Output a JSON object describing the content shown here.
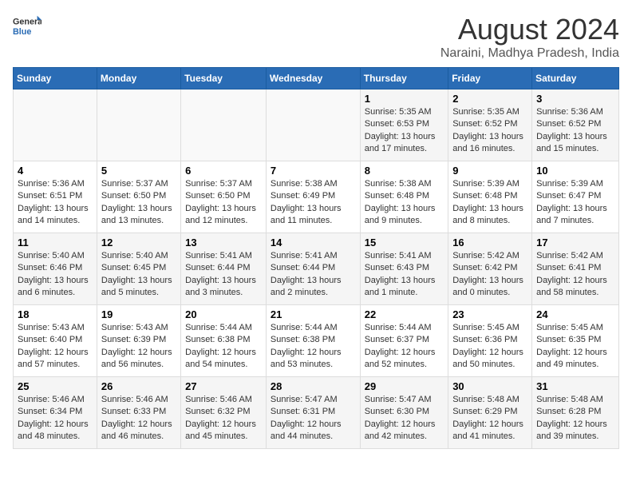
{
  "logo": {
    "line1": "General",
    "line2": "Blue"
  },
  "title": "August 2024",
  "subtitle": "Naraini, Madhya Pradesh, India",
  "days_of_week": [
    "Sunday",
    "Monday",
    "Tuesday",
    "Wednesday",
    "Thursday",
    "Friday",
    "Saturday"
  ],
  "weeks": [
    [
      {
        "day": "",
        "info": ""
      },
      {
        "day": "",
        "info": ""
      },
      {
        "day": "",
        "info": ""
      },
      {
        "day": "",
        "info": ""
      },
      {
        "day": "1",
        "info": "Sunrise: 5:35 AM\nSunset: 6:53 PM\nDaylight: 13 hours and 17 minutes."
      },
      {
        "day": "2",
        "info": "Sunrise: 5:35 AM\nSunset: 6:52 PM\nDaylight: 13 hours and 16 minutes."
      },
      {
        "day": "3",
        "info": "Sunrise: 5:36 AM\nSunset: 6:52 PM\nDaylight: 13 hours and 15 minutes."
      }
    ],
    [
      {
        "day": "4",
        "info": "Sunrise: 5:36 AM\nSunset: 6:51 PM\nDaylight: 13 hours and 14 minutes."
      },
      {
        "day": "5",
        "info": "Sunrise: 5:37 AM\nSunset: 6:50 PM\nDaylight: 13 hours and 13 minutes."
      },
      {
        "day": "6",
        "info": "Sunrise: 5:37 AM\nSunset: 6:50 PM\nDaylight: 13 hours and 12 minutes."
      },
      {
        "day": "7",
        "info": "Sunrise: 5:38 AM\nSunset: 6:49 PM\nDaylight: 13 hours and 11 minutes."
      },
      {
        "day": "8",
        "info": "Sunrise: 5:38 AM\nSunset: 6:48 PM\nDaylight: 13 hours and 9 minutes."
      },
      {
        "day": "9",
        "info": "Sunrise: 5:39 AM\nSunset: 6:48 PM\nDaylight: 13 hours and 8 minutes."
      },
      {
        "day": "10",
        "info": "Sunrise: 5:39 AM\nSunset: 6:47 PM\nDaylight: 13 hours and 7 minutes."
      }
    ],
    [
      {
        "day": "11",
        "info": "Sunrise: 5:40 AM\nSunset: 6:46 PM\nDaylight: 13 hours and 6 minutes."
      },
      {
        "day": "12",
        "info": "Sunrise: 5:40 AM\nSunset: 6:45 PM\nDaylight: 13 hours and 5 minutes."
      },
      {
        "day": "13",
        "info": "Sunrise: 5:41 AM\nSunset: 6:44 PM\nDaylight: 13 hours and 3 minutes."
      },
      {
        "day": "14",
        "info": "Sunrise: 5:41 AM\nSunset: 6:44 PM\nDaylight: 13 hours and 2 minutes."
      },
      {
        "day": "15",
        "info": "Sunrise: 5:41 AM\nSunset: 6:43 PM\nDaylight: 13 hours and 1 minute."
      },
      {
        "day": "16",
        "info": "Sunrise: 5:42 AM\nSunset: 6:42 PM\nDaylight: 13 hours and 0 minutes."
      },
      {
        "day": "17",
        "info": "Sunrise: 5:42 AM\nSunset: 6:41 PM\nDaylight: 12 hours and 58 minutes."
      }
    ],
    [
      {
        "day": "18",
        "info": "Sunrise: 5:43 AM\nSunset: 6:40 PM\nDaylight: 12 hours and 57 minutes."
      },
      {
        "day": "19",
        "info": "Sunrise: 5:43 AM\nSunset: 6:39 PM\nDaylight: 12 hours and 56 minutes."
      },
      {
        "day": "20",
        "info": "Sunrise: 5:44 AM\nSunset: 6:38 PM\nDaylight: 12 hours and 54 minutes."
      },
      {
        "day": "21",
        "info": "Sunrise: 5:44 AM\nSunset: 6:38 PM\nDaylight: 12 hours and 53 minutes."
      },
      {
        "day": "22",
        "info": "Sunrise: 5:44 AM\nSunset: 6:37 PM\nDaylight: 12 hours and 52 minutes."
      },
      {
        "day": "23",
        "info": "Sunrise: 5:45 AM\nSunset: 6:36 PM\nDaylight: 12 hours and 50 minutes."
      },
      {
        "day": "24",
        "info": "Sunrise: 5:45 AM\nSunset: 6:35 PM\nDaylight: 12 hours and 49 minutes."
      }
    ],
    [
      {
        "day": "25",
        "info": "Sunrise: 5:46 AM\nSunset: 6:34 PM\nDaylight: 12 hours and 48 minutes."
      },
      {
        "day": "26",
        "info": "Sunrise: 5:46 AM\nSunset: 6:33 PM\nDaylight: 12 hours and 46 minutes."
      },
      {
        "day": "27",
        "info": "Sunrise: 5:46 AM\nSunset: 6:32 PM\nDaylight: 12 hours and 45 minutes."
      },
      {
        "day": "28",
        "info": "Sunrise: 5:47 AM\nSunset: 6:31 PM\nDaylight: 12 hours and 44 minutes."
      },
      {
        "day": "29",
        "info": "Sunrise: 5:47 AM\nSunset: 6:30 PM\nDaylight: 12 hours and 42 minutes."
      },
      {
        "day": "30",
        "info": "Sunrise: 5:48 AM\nSunset: 6:29 PM\nDaylight: 12 hours and 41 minutes."
      },
      {
        "day": "31",
        "info": "Sunrise: 5:48 AM\nSunset: 6:28 PM\nDaylight: 12 hours and 39 minutes."
      }
    ]
  ]
}
